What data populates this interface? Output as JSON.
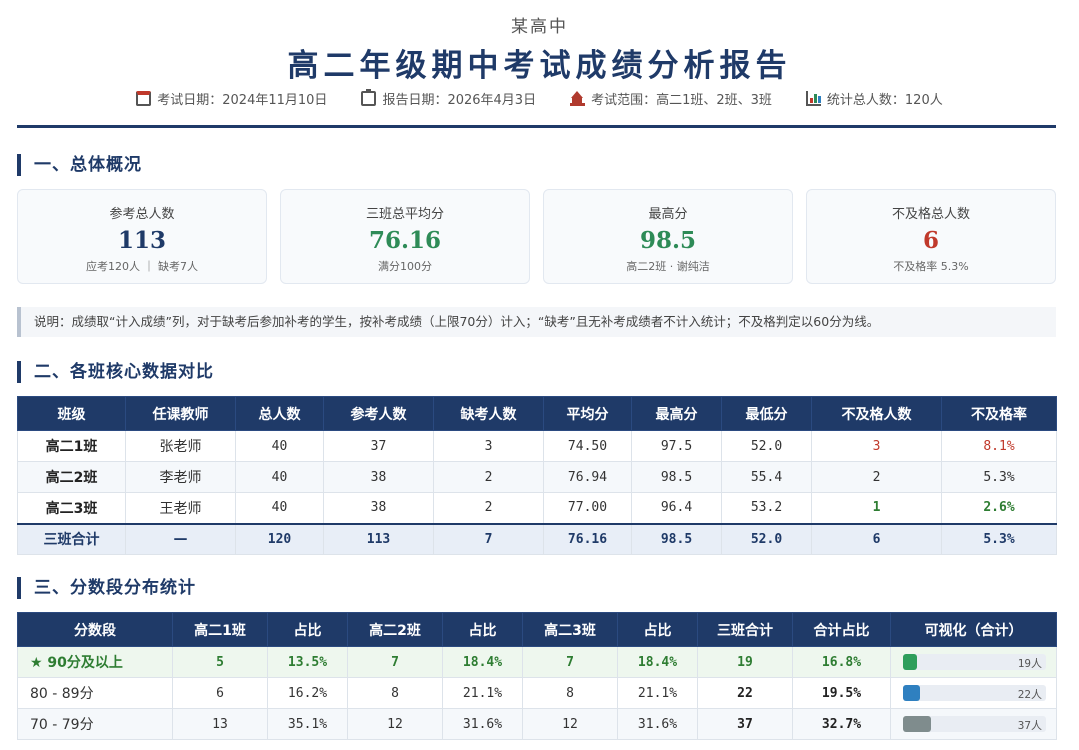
{
  "header": {
    "school": "某高中",
    "title": "高二年级期中考试成绩分析报告",
    "meta": [
      {
        "icon": "calendar-icon",
        "text": "考试日期：2024年11月10日"
      },
      {
        "icon": "clipboard-icon",
        "text": "报告日期：2026年4月3日"
      },
      {
        "icon": "school-icon",
        "text": "考试范围：高二1班、2班、3班"
      },
      {
        "icon": "bar-chart-icon",
        "text": "统计总人数：120人"
      }
    ]
  },
  "section1": {
    "title": "一、总体概况",
    "cards": [
      {
        "label": "参考总人数",
        "value": "113",
        "sub": "应考120人 ｜ 缺考7人",
        "color": "#1f3a68"
      },
      {
        "label": "三班总平均分",
        "value": "76.16",
        "sub": "满分100分",
        "color": "#2e8b57"
      },
      {
        "label": "最高分",
        "value": "98.5",
        "sub": "高二2班 · 谢纯洁",
        "color": "#2e8b57"
      },
      {
        "label": "不及格总人数",
        "value": "6",
        "sub": "不及格率 5.3%",
        "color": "#c0392b"
      }
    ],
    "note": "说明：成绩取“计入成绩”列，对于缺考后参加补考的学生，按补考成绩（上限70分）计入；“缺考”且无补考成绩者不计入统计；不及格判定以60分为线。"
  },
  "section2": {
    "title": "二、各班核心数据对比",
    "headers": [
      "班级",
      "任课教师",
      "总人数",
      "参考人数",
      "缺考人数",
      "平均分",
      "最高分",
      "最低分",
      "不及格人数",
      "不及格率"
    ],
    "rows": [
      [
        "高二1班",
        "张老师",
        "40",
        "37",
        "3",
        "74.50",
        "97.5",
        "52.0",
        "3",
        "8.1%"
      ],
      [
        "高二2班",
        "李老师",
        "40",
        "38",
        "2",
        "76.94",
        "98.5",
        "55.4",
        "2",
        "5.3%"
      ],
      [
        "高二3班",
        "王老师",
        "40",
        "38",
        "2",
        "77.00",
        "96.4",
        "53.2",
        "1",
        "2.6%"
      ]
    ],
    "total": [
      "三班合计",
      "—",
      "120",
      "113",
      "7",
      "76.16",
      "98.5",
      "52.0",
      "6",
      "5.3%"
    ]
  },
  "section3": {
    "title": "三、分数段分布统计",
    "headers": [
      "分数段",
      "高二1班",
      "占比",
      "高二2班",
      "占比",
      "高二3班",
      "占比",
      "三班合计",
      "合计占比",
      "可视化（合计）"
    ],
    "rows": [
      {
        "label": "★ 90分及以上",
        "c1": "5",
        "p1": "13.5%",
        "c2": "7",
        "p2": "18.4%",
        "c3": "7",
        "p3": "18.4%",
        "total": "19",
        "pct": "16.8%",
        "bar_text": "19人",
        "bar_value": 0.168,
        "bar_color": "#2e9e5b"
      },
      {
        "label": "80 - 89分",
        "c1": "6",
        "p1": "16.2%",
        "c2": "8",
        "p2": "21.1%",
        "c3": "8",
        "p3": "21.1%",
        "total": "22",
        "pct": "19.5%",
        "bar_text": "22人",
        "bar_value": 0.195,
        "bar_color": "#2f80c0"
      },
      {
        "label": "70 - 79分",
        "c1": "13",
        "p1": "35.1%",
        "c2": "12",
        "p2": "31.6%",
        "c3": "12",
        "p3": "31.6%",
        "total": "37",
        "pct": "32.7%",
        "bar_text": "37人",
        "bar_value": 0.327,
        "bar_color": "#7f8c8d"
      }
    ]
  }
}
